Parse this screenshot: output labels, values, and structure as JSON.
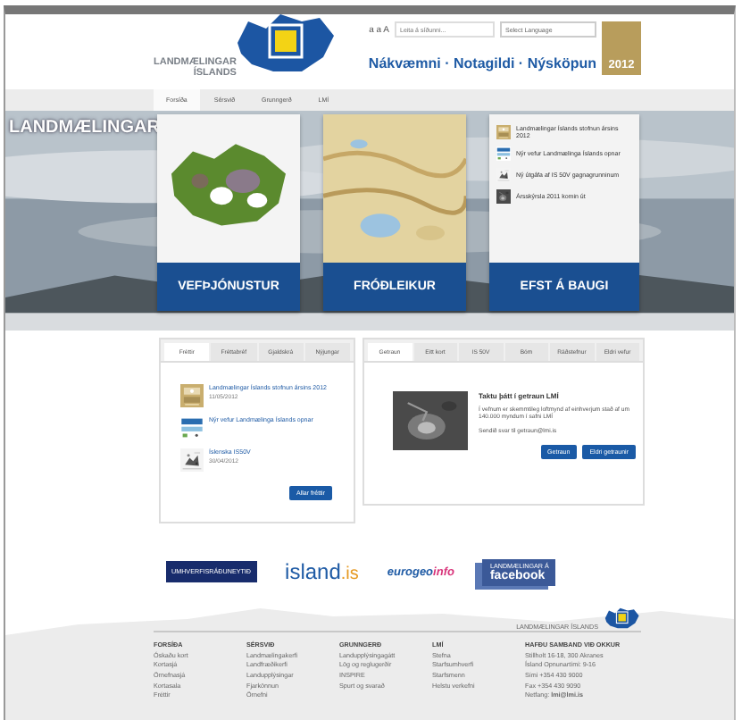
{
  "header": {
    "logo_text": [
      "LANDMÆLINGAR",
      "ÍSLANDS"
    ],
    "font_size_control": "a a A",
    "search": {
      "placeholder": "Leita á síðunni..."
    },
    "language": {
      "placeholder": "Select Language"
    },
    "slogan": "Nákvæmni · Notagildi · Nýsköpun",
    "badge": "2012"
  },
  "nav": [
    {
      "label": "Forsíða",
      "selected": true
    },
    {
      "label": "Sérsvið",
      "selected": false
    },
    {
      "label": "Grunngerð",
      "selected": false
    },
    {
      "label": "LMÍ",
      "selected": false
    }
  ],
  "hero": {
    "watermark": "LANDMÆLINGAR"
  },
  "cards": [
    {
      "kind": "map",
      "title": "VEFÞJÓNUSTUR"
    },
    {
      "kind": "topo",
      "title": "FRÓÐLEIKUR"
    },
    {
      "kind": "news",
      "title": "EFST Á BAUGI",
      "news": [
        "Landmælingar Íslands stofnun ársins 2012",
        "Nýr vefur Landmælinga Íslands opnar",
        "Ný útgáfa af IS 50V gagnagrunninum",
        "Ársskýrsla 2011 komin út"
      ]
    }
  ],
  "news_panel": {
    "tabs": [
      {
        "label": "Fréttir",
        "selected": true
      },
      {
        "label": "Fréttabréf",
        "selected": false
      },
      {
        "label": "Gjaldskrá",
        "selected": false
      },
      {
        "label": "Nýjungar",
        "selected": false
      }
    ],
    "items": [
      {
        "title": "Landmælingar Íslands stofnun ársins 2012",
        "date": "11/05/2012"
      },
      {
        "title": "Nýr vefur Landmælinga Íslands opnar"
      },
      {
        "title": "Íslenska IS50V",
        "date": "30/04/2012"
      }
    ],
    "button": "Allar fréttir"
  },
  "quiz_panel": {
    "tabs": [
      {
        "label": "Getraun",
        "selected": true
      },
      {
        "label": "Eitt kort",
        "selected": false
      },
      {
        "label": "IS 50V",
        "selected": false
      },
      {
        "label": "Bóm",
        "selected": false
      },
      {
        "label": "Ráðstefnur",
        "selected": false
      },
      {
        "label": "Eldri vefur",
        "selected": false
      }
    ],
    "title": "Taktu þátt í getraun LMÍ",
    "text": "Í vefnum er skemmtileg loftmynd af einhverjum stað af um 140.000 myndum í safni LMÍ",
    "contact": "Sendið svar til getraun@lmi.is",
    "buttons": [
      "Getraun",
      "Eldri getraunir"
    ]
  },
  "partners": [
    {
      "kind": "ministry",
      "text": "UMHVERFISRÁÐUNEYTIÐ"
    },
    {
      "kind": "island",
      "text": "island",
      "suffix": ".is"
    },
    {
      "kind": "eurogeo",
      "text": "eurogeo",
      "suffix": "info"
    },
    {
      "kind": "facebook",
      "text": "LANDMÆLINGAR Á",
      "suffix": "facebook"
    }
  ],
  "footer": {
    "logo_text": "LANDMÆLINGAR ÍSLANDS",
    "columns": [
      {
        "heading": "FORSÍÐA",
        "links": [
          "Óskaðu kort",
          "Kortasjá",
          "Örnefnasjá",
          "Kortasala",
          "Fréttir"
        ]
      },
      {
        "heading": "SÉRSVIÐ",
        "links": [
          "Landmælingakerfi",
          "Landfræðikerfi",
          "Landupplýsingar",
          "Fjarkönnun",
          "Örnefni"
        ]
      },
      {
        "heading": "GRUNNGERÐ",
        "links": [
          "Landupplýsingagátt",
          "Lög og reglugerðir",
          "INSPIRE",
          "Spurt og svarað"
        ]
      },
      {
        "heading": "LMÍ",
        "links": [
          "Stefna",
          "Starfsumhverfi",
          "Starfsmenn",
          "Helstu verkefni"
        ]
      }
    ],
    "contact": {
      "heading": "HAFÐU SAMBAND VIÐ OKKUR",
      "lines": [
        "Stillholt 16-18, 300 Akranes",
        "Ísland Opnunartími: 9-16",
        "Sími +354 430 9000",
        "Fax +354 430 9090"
      ],
      "email": "Netfang: **lmi@lmi.is**"
    }
  }
}
